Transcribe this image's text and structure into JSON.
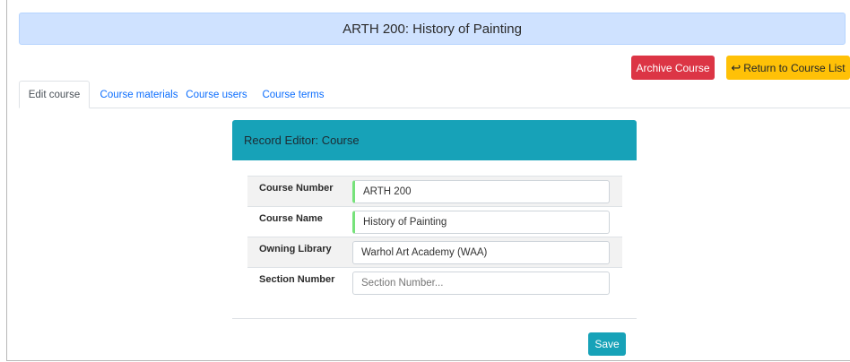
{
  "header": {
    "title": "ARTH 200: History of Painting"
  },
  "actions": {
    "archive_label": "Archive Course",
    "return_label": "Return to Course List"
  },
  "tabs": [
    {
      "label": "Edit course",
      "active": true
    },
    {
      "label": "Course materials",
      "active": false
    },
    {
      "label": "Course users",
      "active": false
    },
    {
      "label": "Course terms",
      "active": false
    }
  ],
  "editor": {
    "title": "Record Editor: Course",
    "fields": [
      {
        "label": "Course Number",
        "value": "ARTH 200",
        "required": true
      },
      {
        "label": "Course Name",
        "value": "History of Painting",
        "required": true
      },
      {
        "label": "Owning Library",
        "value": "Warhol Art Academy (WAA)",
        "required": false
      },
      {
        "label": "Section Number",
        "value": "",
        "placeholder": "Section Number...",
        "required": false
      }
    ],
    "save_label": "Save"
  },
  "colors": {
    "banner_bg": "#cfe2ff",
    "danger": "#dc3545",
    "warning": "#ffc107",
    "info": "#17a2b8",
    "required_marker": "#76e27a"
  }
}
